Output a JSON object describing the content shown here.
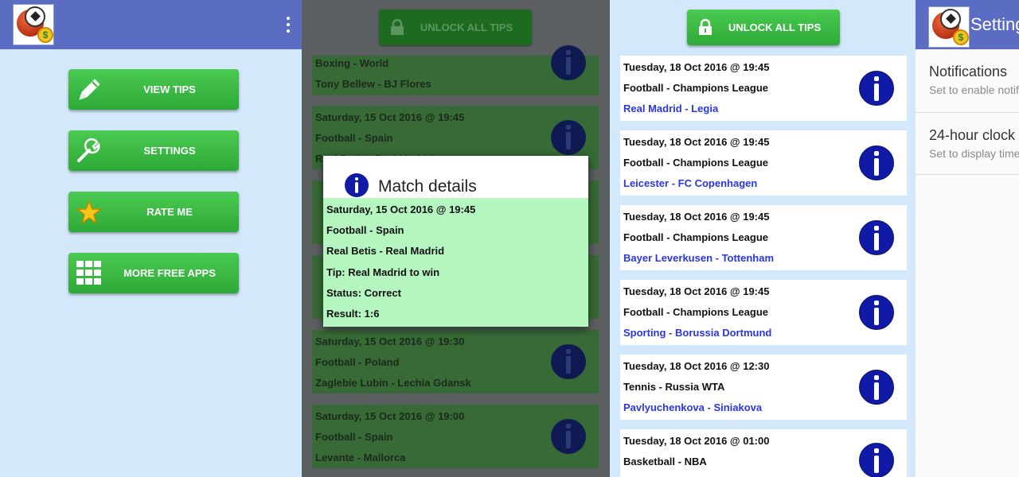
{
  "menu": {
    "buttons": [
      {
        "label": "VIEW TIPS",
        "icon": "pencil-icon"
      },
      {
        "label": "SETTINGS",
        "icon": "wrench-icon"
      },
      {
        "label": "RATE ME",
        "icon": "star-icon"
      },
      {
        "label": "MORE FREE APPS",
        "icon": "grid-icon"
      }
    ]
  },
  "tips_dimmed": {
    "unlock_label": "UNLOCK ALL TIPS",
    "cards": [
      {
        "line1": "Boxing - World",
        "line2": "Tony Bellew - BJ Flores",
        "line3": ""
      },
      {
        "line1": "Saturday, 15 Oct 2016 @ 19:45",
        "line2": "Football - Spain",
        "line3": "Real Betis - Real Madrid"
      },
      {
        "line1": "Saturday, 15 Oct 2016 @ 19:30",
        "line2": "Football - Poland",
        "line3": "Zaglebie Lubin - Lechia Gdansk"
      },
      {
        "line1": "Saturday, 15 Oct 2016 @ 19:00",
        "line2": "Football - Spain",
        "line3": "Levante - Mallorca"
      }
    ],
    "dialog": {
      "title": "Match details",
      "rows": [
        "Saturday, 15 Oct 2016 @ 19:45",
        "Football - Spain",
        "Real Betis - Real Madrid",
        "Tip: Real Madrid to win",
        "Status: Correct",
        "Result: 1:6"
      ]
    }
  },
  "tips": {
    "unlock_label": "UNLOCK ALL TIPS",
    "cards": [
      {
        "date": "Tuesday, 18 Oct 2016 @ 19:45",
        "sport": "Football - Champions League",
        "teams": "Real Madrid - Legia"
      },
      {
        "date": "Tuesday, 18 Oct 2016 @ 19:45",
        "sport": "Football - Champions League",
        "teams": "Leicester - FC Copenhagen"
      },
      {
        "date": "Tuesday, 18 Oct 2016 @ 19:45",
        "sport": "Football - Champions League",
        "teams": "Bayer Leverkusen - Tottenham"
      },
      {
        "date": "Tuesday, 18 Oct 2016 @ 19:45",
        "sport": "Football - Champions League",
        "teams": "Sporting - Borussia Dortmund"
      },
      {
        "date": "Tuesday, 18 Oct 2016 @ 12:30",
        "sport": "Tennis - Russia WTA",
        "teams": "Pavlyuchenkova - Siniakova"
      },
      {
        "date": "Tuesday, 18 Oct 2016 @ 01:00",
        "sport": "Basketball - NBA",
        "teams": ""
      }
    ]
  },
  "settings": {
    "title": "Settings",
    "items": [
      {
        "title": "Notifications",
        "subtitle": "Set to enable notifications"
      },
      {
        "title": "24-hour clock",
        "subtitle": "Set to display time"
      }
    ]
  },
  "colors": {
    "appbar": "#5a6dc3",
    "green_button": "#34b43d",
    "background": "#d3e8fb",
    "dialog_body": "#b5f5c0",
    "team_link": "#2a36e0",
    "info_icon": "#101aa6"
  }
}
